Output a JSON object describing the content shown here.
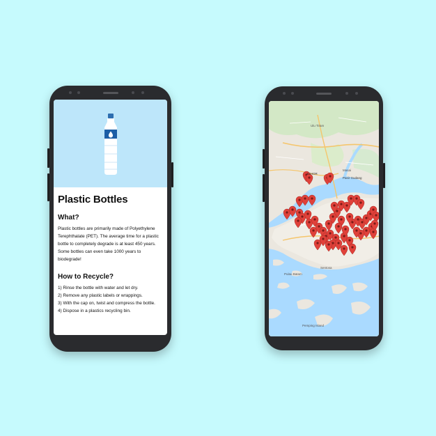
{
  "info_card": {
    "title": "Plastic Bottles",
    "what_heading": "What?",
    "what_lines": [
      "Plastic bottles are primarily made of Polyethylene",
      "Terephthalate (PET). The average time for a plastic",
      "bottle to completely degrade is at least 450 years.",
      "Some bottles can even take 1000 years to biodegrade!"
    ],
    "recycle_heading": "How to Recycle?",
    "steps": [
      "1) Rinse the bottle with water and let dry.",
      "2) Remove any plastic labels or wrappings.",
      "3) With the cap on, twist and compress the bottle.",
      "4) Dispose in a plastics recycling bin."
    ],
    "bottle_icon": "water-drop-icon"
  },
  "map": {
    "labels": {
      "ulu_tiram": "Ulu Tiram",
      "johor": "JOHOR",
      "pasir_gudang": "Pasir Gudang",
      "masai": "Masai",
      "sentosa": "Sentosa",
      "batam": "Pulau Batam",
      "pemping": "Pemping Island"
    },
    "marker_icon": "map-pin-icon",
    "colors": {
      "water": "#aadaff",
      "land": "#ebe7df",
      "marker": "#e0413a"
    }
  }
}
